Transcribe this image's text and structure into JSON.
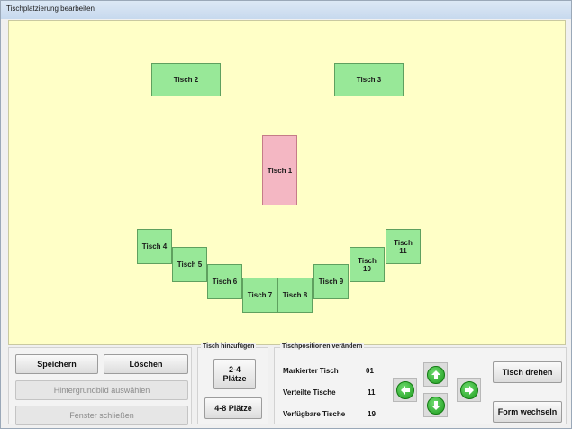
{
  "window": {
    "title": "Tischplatzierung bearbeiten"
  },
  "tables": [
    {
      "id": "t2",
      "label": "Tisch 2",
      "selected": false
    },
    {
      "id": "t3",
      "label": "Tisch 3",
      "selected": false
    },
    {
      "id": "t1",
      "label": "Tisch 1",
      "selected": true
    },
    {
      "id": "t4",
      "label": "Tisch 4",
      "selected": false
    },
    {
      "id": "t5",
      "label": "Tisch 5",
      "selected": false
    },
    {
      "id": "t6",
      "label": "Tisch 6",
      "selected": false
    },
    {
      "id": "t7",
      "label": "Tisch 7",
      "selected": false
    },
    {
      "id": "t8",
      "label": "Tisch 8",
      "selected": false
    },
    {
      "id": "t9",
      "label": "Tisch 9",
      "selected": false
    },
    {
      "id": "t10",
      "label": "Tisch\n10",
      "selected": false
    },
    {
      "id": "t11",
      "label": "Tisch\n11",
      "selected": false
    }
  ],
  "actions": {
    "save": "Speichern",
    "delete": "Löschen",
    "choose_background": "Hintergrundbild auswählen",
    "close_window": "Fenster schließen"
  },
  "add_table": {
    "group_label": "Tisch hinzufügen",
    "small": "2-4\nPlätze",
    "large": "4-8 Plätze"
  },
  "positions": {
    "group_label": "Tischpositionen verändern",
    "marked_label": "Markierter Tisch",
    "marked_value": "01",
    "distributed_label": "Verteilte Tische",
    "distributed_value": "11",
    "available_label": "Verfügbare Tische",
    "available_value": "19",
    "rotate": "Tisch drehen",
    "change_shape": "Form wechseln"
  },
  "colors": {
    "canvas_bg": "#ffffc7",
    "table_green": "#98e898",
    "table_selected": "#f4b7c3",
    "arrow_green": "#1c9a1c"
  }
}
